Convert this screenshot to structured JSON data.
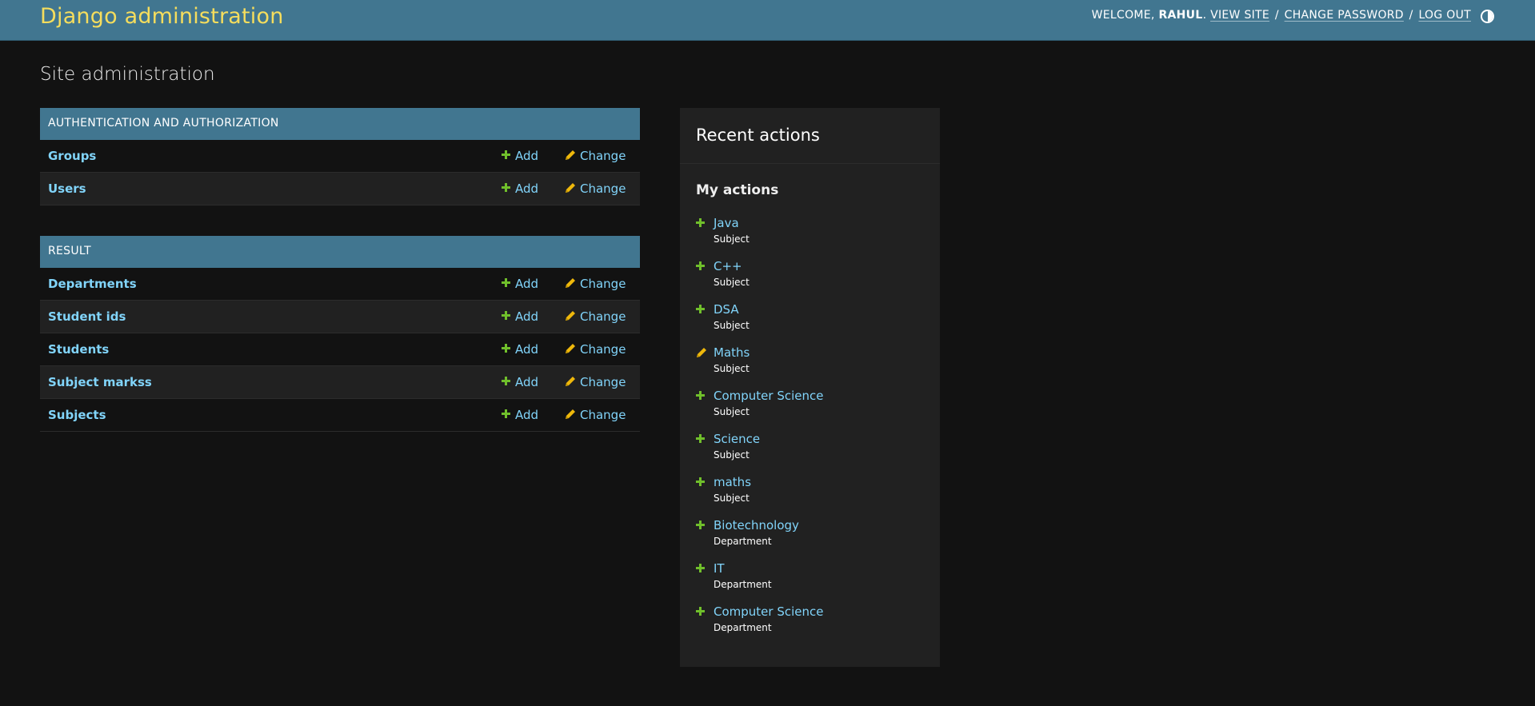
{
  "header": {
    "branding": "Django administration",
    "welcome": "WELCOME,",
    "username": "RAHUL",
    "links": [
      "VIEW SITE",
      "CHANGE PASSWORD",
      "LOG OUT"
    ],
    "separator": "/",
    "theme_toggle_icon": "half-circle-contrast-icon",
    "colors": {
      "header_bg": "#417690",
      "branding": "#f5dd5d"
    }
  },
  "page_title": "Site administration",
  "modules": [
    {
      "caption": "AUTHENTICATION AND AUTHORIZATION",
      "models": [
        "Groups",
        "Users"
      ]
    },
    {
      "caption": "RESULT",
      "models": [
        "Departments",
        "Student ids",
        "Students",
        "Subject markss",
        "Subjects"
      ]
    }
  ],
  "row_actions": {
    "add_label": "Add",
    "change_label": "Change"
  },
  "recent_actions": {
    "title": "Recent actions",
    "subtitle": "My actions",
    "items": [
      {
        "name": "Java",
        "type": "Subject",
        "action": "add"
      },
      {
        "name": "C++",
        "type": "Subject",
        "action": "add"
      },
      {
        "name": "DSA",
        "type": "Subject",
        "action": "add"
      },
      {
        "name": "Maths",
        "type": "Subject",
        "action": "change"
      },
      {
        "name": "Computer Science",
        "type": "Subject",
        "action": "add"
      },
      {
        "name": "Science",
        "type": "Subject",
        "action": "add"
      },
      {
        "name": "maths",
        "type": "Subject",
        "action": "add"
      },
      {
        "name": "Biotechnology",
        "type": "Department",
        "action": "add"
      },
      {
        "name": "IT",
        "type": "Department",
        "action": "add"
      },
      {
        "name": "Computer Science",
        "type": "Department",
        "action": "add"
      }
    ]
  },
  "colors": {
    "link": "#81d4fa",
    "add_icon": "#70bf2b",
    "change_icon": "#efb80b",
    "background": "#121212",
    "panel": "#212121"
  }
}
